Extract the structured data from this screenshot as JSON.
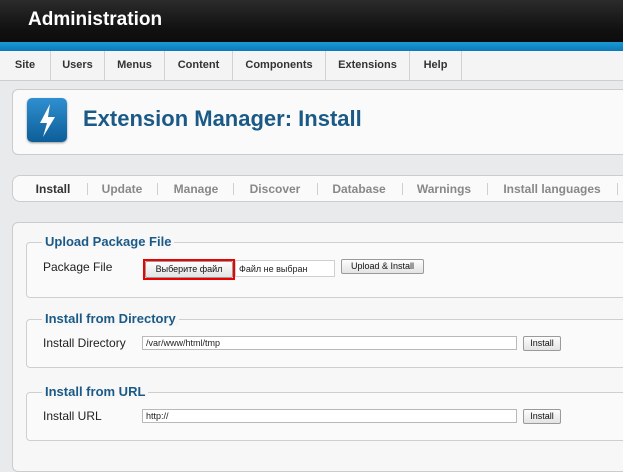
{
  "header": {
    "title": "Administration"
  },
  "menu": [
    {
      "label": "Site"
    },
    {
      "label": "Users"
    },
    {
      "label": "Menus"
    },
    {
      "label": "Content"
    },
    {
      "label": "Components"
    },
    {
      "label": "Extensions"
    },
    {
      "label": "Help"
    }
  ],
  "page": {
    "title": "Extension Manager: Install",
    "icon": "extension-lightning-icon"
  },
  "tabs": [
    {
      "label": "Install",
      "active": true
    },
    {
      "label": "Update"
    },
    {
      "label": "Manage"
    },
    {
      "label": "Discover"
    },
    {
      "label": "Database"
    },
    {
      "label": "Warnings"
    },
    {
      "label": "Install languages"
    }
  ],
  "upload": {
    "legend": "Upload Package File",
    "label": "Package File",
    "choose_button": "Выберите файл",
    "file_status": "Файл не выбран",
    "install_button": "Upload & Install"
  },
  "directory": {
    "legend": "Install from Directory",
    "label": "Install Directory",
    "value": "/var/www/html/tmp",
    "install_button": "Install"
  },
  "url": {
    "legend": "Install from URL",
    "label": "Install URL",
    "value": "http://",
    "install_button": "Install"
  },
  "colors": {
    "header_bg": "#111111",
    "accent_blue": "#1a9ad6",
    "title_blue": "#1b5a87",
    "highlight_red": "#ee0000"
  }
}
